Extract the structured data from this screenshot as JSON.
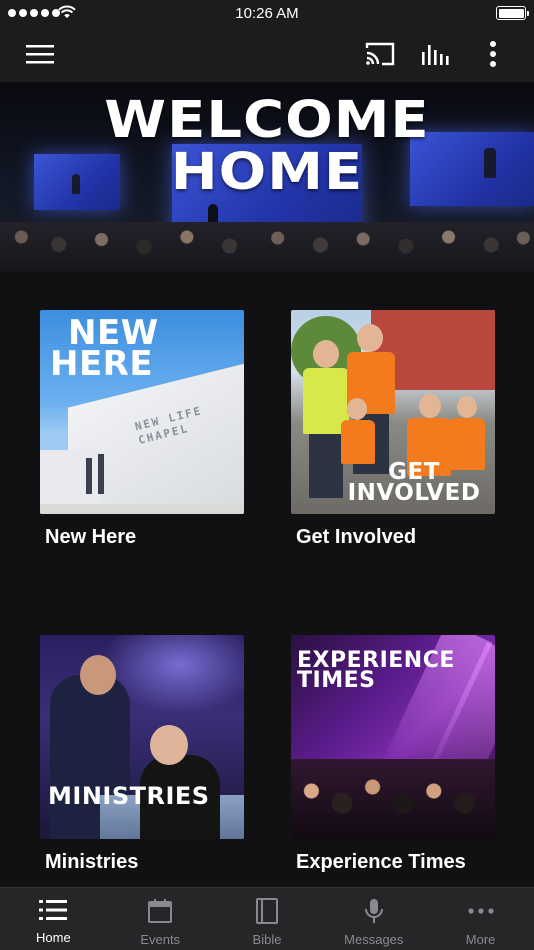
{
  "status_bar": {
    "time": "10:26 AM",
    "signal_icon": "signal-dots-icon",
    "wifi_icon": "wifi-icon",
    "battery_icon": "battery-icon",
    "battery_level": 1.0
  },
  "nav_bar": {
    "menu_icon": "hamburger-menu-icon",
    "cast_icon": "cast-icon",
    "audio_icon": "audio-bars-icon",
    "more_icon": "vertical-dots-icon"
  },
  "hero": {
    "line1": "WELCOME",
    "line2": "HOME"
  },
  "cards": [
    {
      "overlay": [
        "NEW",
        "HERE"
      ],
      "label": "New Here",
      "building_sign": [
        "NEW LIFE",
        "CHAPEL"
      ]
    },
    {
      "overlay": [
        "GET",
        "INVOLVED"
      ],
      "label": "Get Involved"
    },
    {
      "overlay": [
        "MINISTRIES"
      ],
      "label": "Ministries"
    },
    {
      "overlay": [
        "EXPERIENCE",
        "TIMES"
      ],
      "label": "Experience Times"
    }
  ],
  "tabs": [
    {
      "label": "Home",
      "icon": "list-icon",
      "active": true
    },
    {
      "label": "Events",
      "icon": "calendar-icon",
      "active": false
    },
    {
      "label": "Bible",
      "icon": "book-icon",
      "active": false
    },
    {
      "label": "Messages",
      "icon": "microphone-icon",
      "active": false
    },
    {
      "label": "More",
      "icon": "more-dots-icon",
      "active": false
    }
  ],
  "colors": {
    "background": "#111114",
    "bar": "#1c1c1e",
    "tab_bar": "#262628",
    "tab_inactive": "#8a8a8e",
    "tab_active": "#ffffff"
  }
}
